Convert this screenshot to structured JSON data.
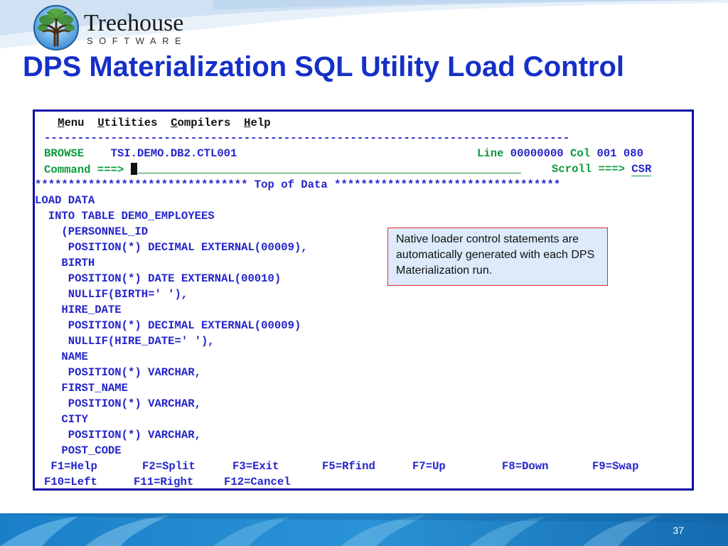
{
  "logo": {
    "name": "Treehouse",
    "subtitle": "SOFTWARE"
  },
  "slide": {
    "title": "DPS Materialization SQL Utility Load Control",
    "page_number": "37"
  },
  "terminal": {
    "menu": [
      {
        "prefix": "",
        "hotkey": "M",
        "rest": "enu"
      },
      {
        "prefix": "",
        "hotkey": "U",
        "rest": "tilities"
      },
      {
        "prefix": "",
        "hotkey": "C",
        "rest": "ompilers"
      },
      {
        "prefix": "",
        "hotkey": "H",
        "rest": "elp"
      }
    ],
    "separator": "-------------------------------------------------------------------------------",
    "mode": "BROWSE",
    "dataset": "TSI.DEMO.DB2.CTL001",
    "line_label": "Line",
    "line_value": "00000000",
    "col_label": "Col",
    "col_value": "001 080",
    "command_label": "Command ===>",
    "command_value": "",
    "scroll_label": "Scroll ===>",
    "scroll_value": "CSR",
    "top_of_data": "******************************** Top of Data **********************************",
    "code_lines": [
      "LOAD DATA",
      "  INTO TABLE DEMO_EMPLOYEES",
      "    (PERSONNEL_ID",
      "     POSITION(*) DECIMAL EXTERNAL(00009),",
      "    BIRTH",
      "     POSITION(*) DATE EXTERNAL(00010)",
      "     NULLIF(BIRTH=' '),",
      "    HIRE_DATE",
      "     POSITION(*) DECIMAL EXTERNAL(00009)",
      "     NULLIF(HIRE_DATE=' '),",
      "    NAME",
      "     POSITION(*) VARCHAR,",
      "    FIRST_NAME",
      "     POSITION(*) VARCHAR,",
      "    CITY",
      "     POSITION(*) VARCHAR,",
      "    POST_CODE"
    ],
    "pf_keys_row1": [
      " F1=Help",
      "F2=Split",
      "F3=Exit",
      "F5=Rfind",
      "F7=Up",
      "F8=Down",
      "F9=Swap"
    ],
    "pf_keys_row2": [
      "F10=Left",
      "F11=Right",
      "F12=Cancel"
    ]
  },
  "callout": {
    "text": "Native loader control statements are automatically generated with each DPS Materialization run."
  },
  "colors": {
    "title": "#1530c8",
    "terminal_border": "#1010a8",
    "terminal_blue": "#2424cc",
    "terminal_green": "#0a9b3b",
    "callout_border": "#e02a2a",
    "callout_fill": "#dceafa",
    "band": "#1a7fc8"
  }
}
